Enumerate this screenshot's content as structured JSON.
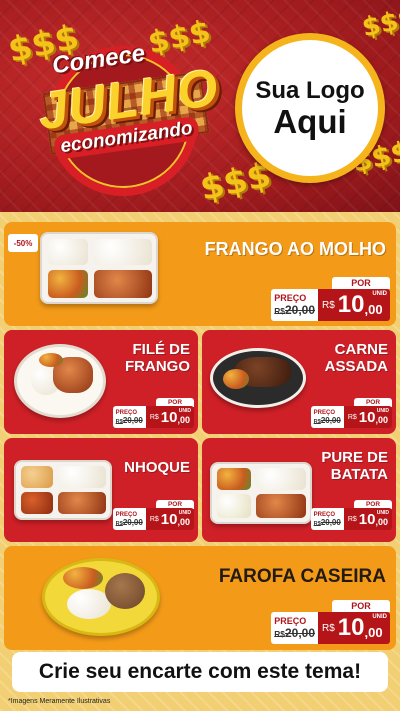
{
  "header": {
    "dollar_sign": "$$$",
    "badge": {
      "top": "Comece",
      "main": "JULHO",
      "bottom": "economizando"
    },
    "logo": {
      "line1": "Sua Logo",
      "line2": "Aqui"
    }
  },
  "colors": {
    "red": "#cf2027",
    "orange": "#f39a18",
    "dark_red": "#b51519",
    "gold": "#f6b41c"
  },
  "products": [
    {
      "name": "FRANGO AO MOLHO",
      "discount": "-50%",
      "por": "POR",
      "preco_label": "PREÇO",
      "old_currency": "R$",
      "old_price": "20,00",
      "currency": "R$",
      "price_int": "10",
      "price_cents": ",00",
      "unit": "UNID",
      "icon": "meal-tray-chicken-icon"
    },
    {
      "name": "FILÉ DE FRANGO",
      "por": "POR",
      "preco_label": "PREÇO",
      "old_currency": "R$",
      "old_price": "20,00",
      "currency": "R$",
      "price_int": "10",
      "price_cents": ",00",
      "unit": "UNID",
      "icon": "plate-chicken-fillet-icon"
    },
    {
      "name": "CARNE ASSADA",
      "por": "POR",
      "preco_label": "PREÇO",
      "old_currency": "R$",
      "old_price": "20,00",
      "currency": "R$",
      "price_int": "10",
      "price_cents": ",00",
      "unit": "UNID",
      "icon": "bowl-roast-beef-icon"
    },
    {
      "name": "NHOQUE",
      "por": "POR",
      "preco_label": "PREÇO",
      "old_currency": "R$",
      "old_price": "20,00",
      "currency": "R$",
      "price_int": "10",
      "price_cents": ",00",
      "unit": "UNID",
      "icon": "meal-tray-gnocchi-icon"
    },
    {
      "name": "PURE DE BATATA",
      "por": "POR",
      "preco_label": "PREÇO",
      "old_currency": "R$",
      "old_price": "20,00",
      "currency": "R$",
      "price_int": "10",
      "price_cents": ",00",
      "unit": "UNID",
      "icon": "meal-tray-mashed-potato-icon"
    },
    {
      "name": "FAROFA CASEIRA",
      "por": "POR",
      "preco_label": "PREÇO",
      "old_currency": "R$",
      "old_price": "20,00",
      "currency": "R$",
      "price_int": "10",
      "price_cents": ",00",
      "unit": "UNID",
      "icon": "bowl-farofa-icon"
    }
  ],
  "banner": "Crie seu encarte com este tema!",
  "footnote": "*Imagens Meramente Ilustrativas"
}
